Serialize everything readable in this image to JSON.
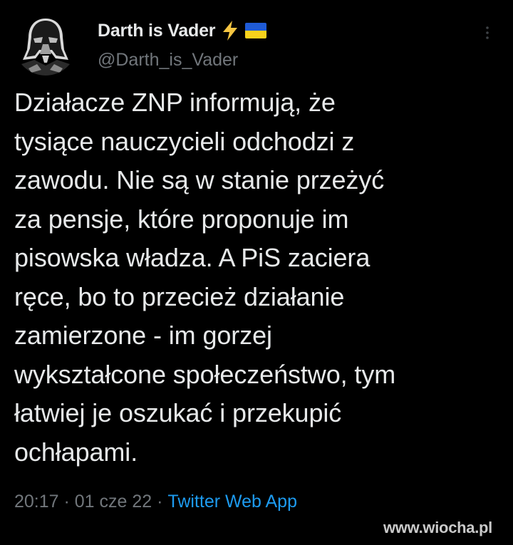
{
  "author": {
    "display_name": "Darth is Vader",
    "handle": "@Darth_is_Vader",
    "badges": [
      "lightning-icon",
      "ukraine-flag-icon"
    ]
  },
  "tweet": {
    "text": "Działacze ZNP informują, że\ntysiące nauczycieli odchodzi z\nzawodu. Nie są w stanie przeżyć\nza pensje, które proponuje im\npisowska władza. A PiS zaciera\nręce, bo to przecież działanie\nzamierzone - im gorzej\nwykształcone społeczeństwo, tym\nłatwiej je oszukać i przekupić\nochłapami.",
    "time": "20:17",
    "separator": " · ",
    "date": "01 cze 22",
    "source": "Twitter Web App"
  },
  "watermark": "www.wiocha.pl",
  "colors": {
    "background": "#000000",
    "text": "#e7e9ea",
    "secondary": "#71767b",
    "link": "#1d9bf0",
    "lightning": "#f5c542",
    "flag_blue": "#1f5bd6",
    "flag_yellow": "#f8d21c"
  }
}
